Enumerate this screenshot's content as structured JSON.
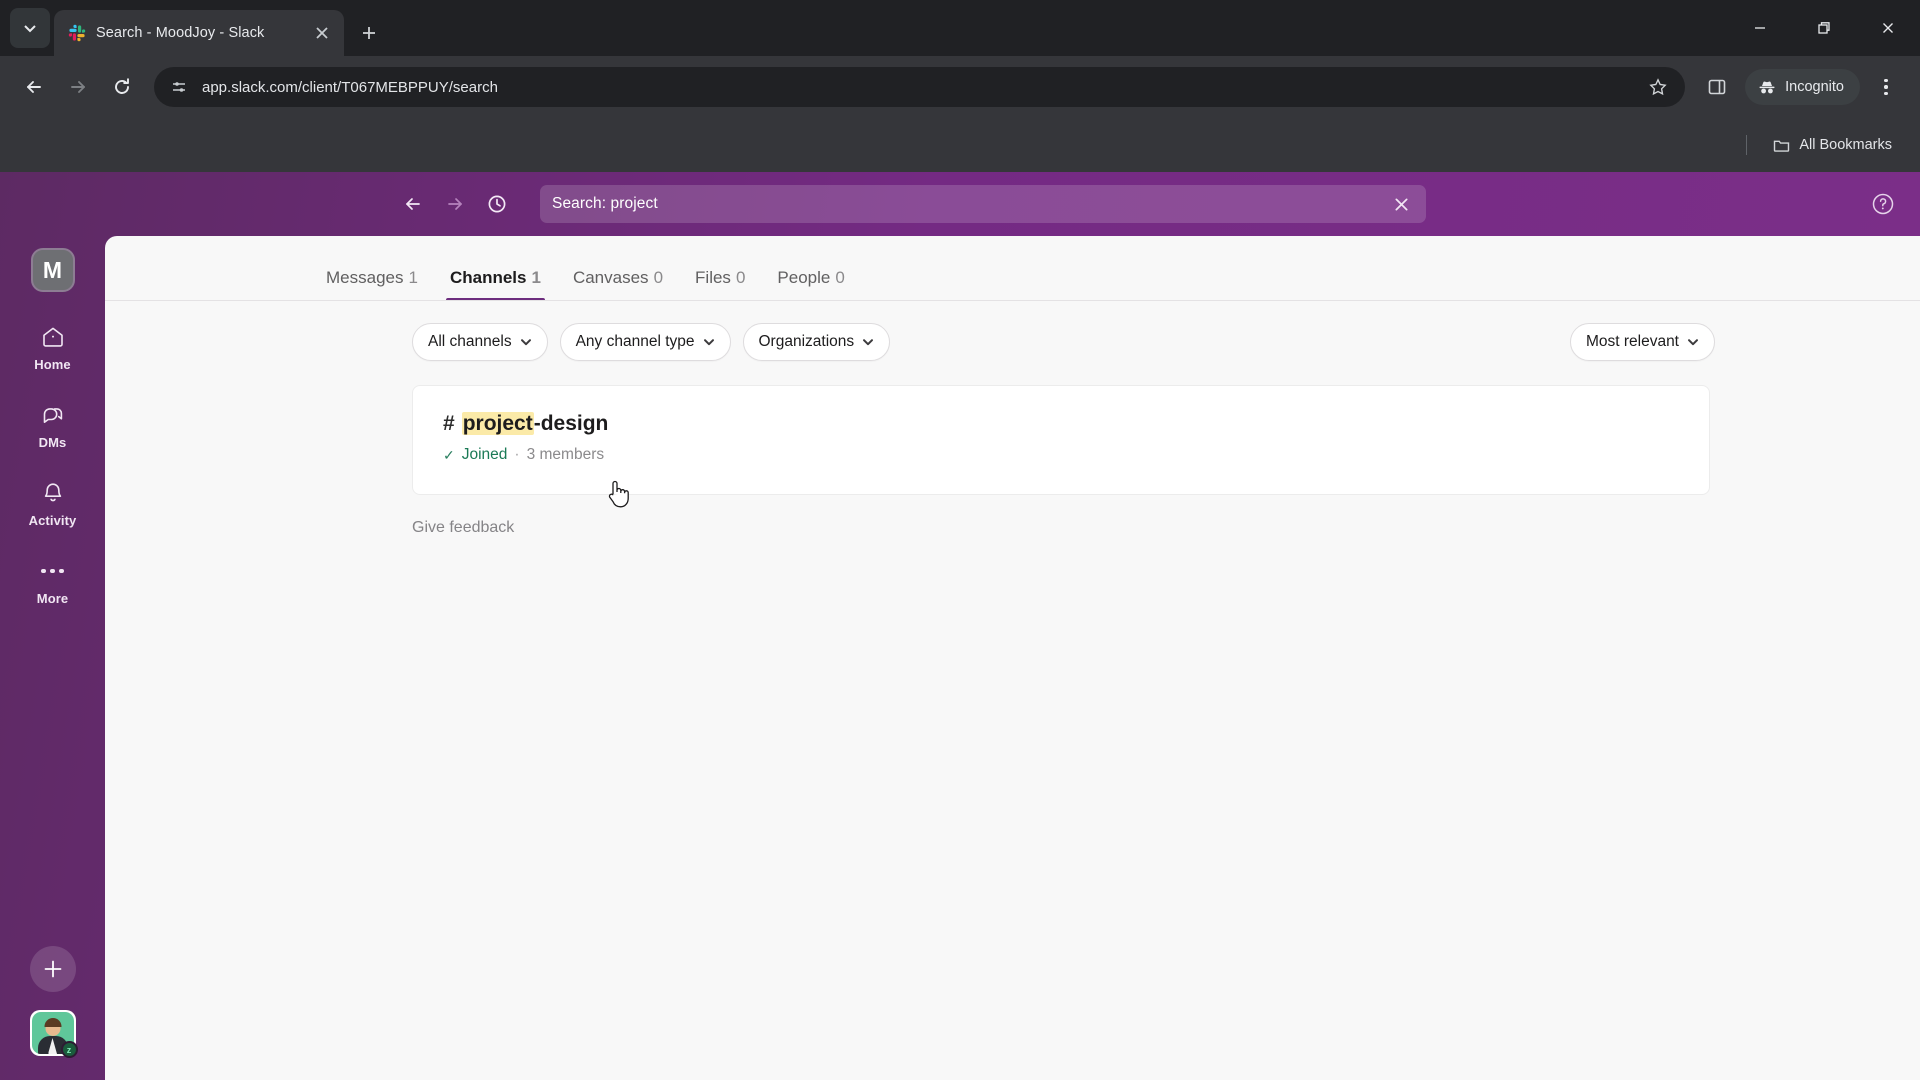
{
  "browser": {
    "tab": {
      "title": "Search - MoodJoy - Slack",
      "favicon": "slack-logo-icon"
    },
    "new_tab_label": "+",
    "url": "app.slack.com/client/T067MEBPPUY/search",
    "incognito_label": "Incognito",
    "bookmarks": {
      "all_bookmarks_label": "All Bookmarks"
    },
    "window_controls": {
      "minimize": "minimize-icon",
      "maximize": "restore-icon",
      "close": "close-icon"
    }
  },
  "slack": {
    "search": {
      "value": "Search: project",
      "clear_label": "clear-search"
    },
    "help_label": "?",
    "workspace": {
      "initial": "M",
      "name": "MoodJoy"
    },
    "rail": {
      "items": [
        {
          "label": "Home",
          "icon": "home-icon"
        },
        {
          "label": "DMs",
          "icon": "dms-icon"
        },
        {
          "label": "Activity",
          "icon": "bell-icon"
        },
        {
          "label": "More",
          "icon": "ellipsis-icon"
        }
      ],
      "new_button_label": "+",
      "presence": "z"
    },
    "tabs": [
      {
        "label": "Messages",
        "count": "1",
        "active": false
      },
      {
        "label": "Channels",
        "count": "1",
        "active": true
      },
      {
        "label": "Canvases",
        "count": "0",
        "active": false
      },
      {
        "label": "Files",
        "count": "0",
        "active": false
      },
      {
        "label": "People",
        "count": "0",
        "active": false
      }
    ],
    "filters": [
      {
        "label": "All channels"
      },
      {
        "label": "Any channel type"
      },
      {
        "label": "Organizations"
      }
    ],
    "sort": {
      "label": "Most relevant"
    },
    "results": [
      {
        "hash": "#",
        "name_highlight": "project",
        "name_rest": "-design",
        "check": "✓",
        "joined": "Joined",
        "separator": "·",
        "members": "3 members"
      }
    ],
    "feedback_label": "Give feedback",
    "accent_color": "#6d2d7e",
    "highlight_color": "#fbeaa8",
    "joined_color": "#1b7a56"
  }
}
